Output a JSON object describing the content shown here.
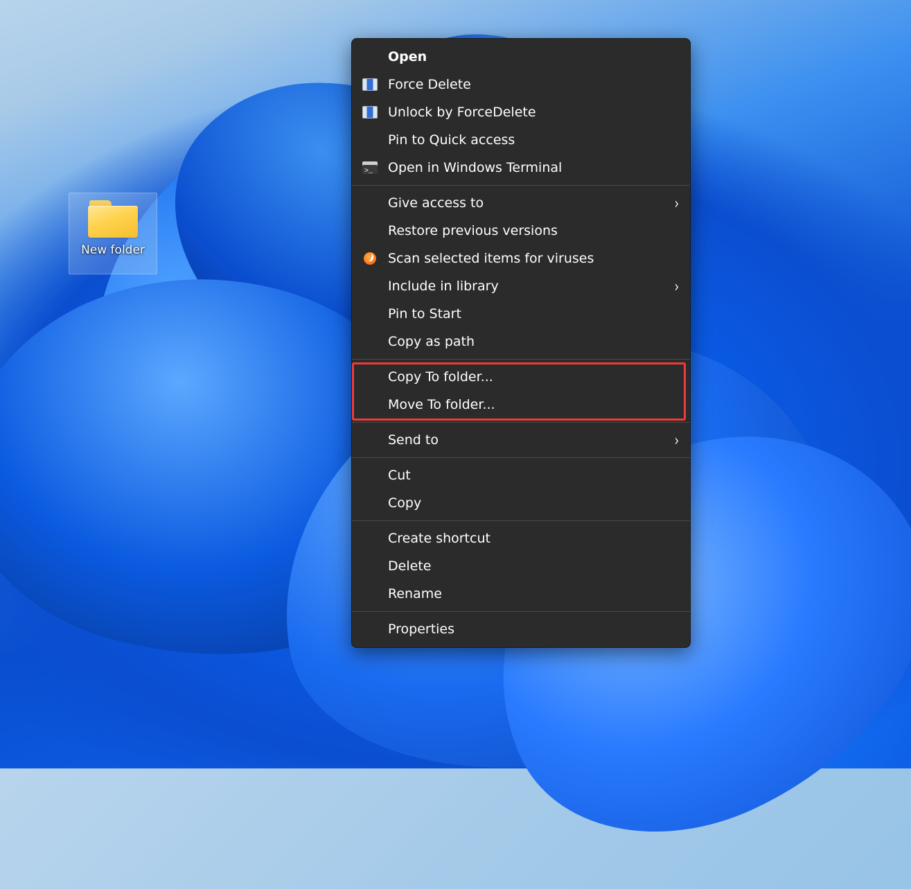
{
  "desktop": {
    "icon_label": "New folder"
  },
  "context_menu": {
    "groups": [
      [
        {
          "id": "open",
          "label": "Open",
          "bold": true,
          "icon": null,
          "submenu": false
        },
        {
          "id": "force-delete",
          "label": "Force Delete",
          "bold": false,
          "icon": "fd",
          "submenu": false
        },
        {
          "id": "unlock-forcedelete",
          "label": "Unlock by ForceDelete",
          "bold": false,
          "icon": "fd",
          "submenu": false
        },
        {
          "id": "pin-quick-access",
          "label": "Pin to Quick access",
          "bold": false,
          "icon": null,
          "submenu": false
        },
        {
          "id": "open-terminal",
          "label": "Open in Windows Terminal",
          "bold": false,
          "icon": "terminal",
          "submenu": false
        }
      ],
      [
        {
          "id": "give-access-to",
          "label": "Give access to",
          "bold": false,
          "icon": null,
          "submenu": true
        },
        {
          "id": "restore-previous",
          "label": "Restore previous versions",
          "bold": false,
          "icon": null,
          "submenu": false
        },
        {
          "id": "scan-viruses",
          "label": "Scan selected items for viruses",
          "bold": false,
          "icon": "avast",
          "submenu": false
        },
        {
          "id": "include-library",
          "label": "Include in library",
          "bold": false,
          "icon": null,
          "submenu": true
        },
        {
          "id": "pin-start",
          "label": "Pin to Start",
          "bold": false,
          "icon": null,
          "submenu": false
        },
        {
          "id": "copy-as-path",
          "label": "Copy as path",
          "bold": false,
          "icon": null,
          "submenu": false
        }
      ],
      [
        {
          "id": "copy-to-folder",
          "label": "Copy To folder...",
          "bold": false,
          "icon": null,
          "submenu": false,
          "highlight": true
        },
        {
          "id": "move-to-folder",
          "label": "Move To folder...",
          "bold": false,
          "icon": null,
          "submenu": false,
          "highlight": true
        }
      ],
      [
        {
          "id": "send-to",
          "label": "Send to",
          "bold": false,
          "icon": null,
          "submenu": true
        }
      ],
      [
        {
          "id": "cut",
          "label": "Cut",
          "bold": false,
          "icon": null,
          "submenu": false
        },
        {
          "id": "copy",
          "label": "Copy",
          "bold": false,
          "icon": null,
          "submenu": false
        }
      ],
      [
        {
          "id": "create-shortcut",
          "label": "Create shortcut",
          "bold": false,
          "icon": null,
          "submenu": false
        },
        {
          "id": "delete",
          "label": "Delete",
          "bold": false,
          "icon": null,
          "submenu": false
        },
        {
          "id": "rename",
          "label": "Rename",
          "bold": false,
          "icon": null,
          "submenu": false
        }
      ],
      [
        {
          "id": "properties",
          "label": "Properties",
          "bold": false,
          "icon": null,
          "submenu": false
        }
      ]
    ],
    "highlight_color": "#ef3a3a"
  }
}
